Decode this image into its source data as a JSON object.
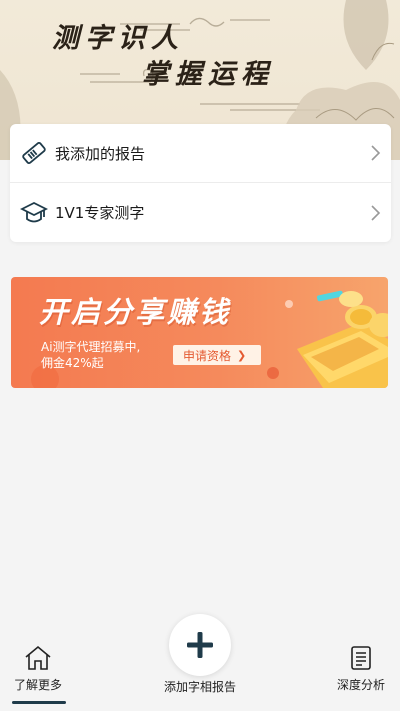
{
  "hero": {
    "title_line1": "测字识人",
    "title_line2": "掌握运程"
  },
  "menu": {
    "items": [
      {
        "label": "我添加的报告",
        "icon": "ticket-icon"
      },
      {
        "label": "1V1专家测字",
        "icon": "graduation-cap-icon"
      }
    ]
  },
  "banner": {
    "title": "开启分享赚钱",
    "subtitle_line1": "Ai测字代理招募中,",
    "subtitle_line2": "佣金42%起",
    "button_label": "申请资格"
  },
  "tabbar": {
    "items": [
      {
        "label": "了解更多",
        "icon": "home-icon",
        "active": true
      },
      {
        "label": "添加字相报告",
        "icon": "plus-icon"
      },
      {
        "label": "深度分析",
        "icon": "document-icon"
      }
    ]
  },
  "colors": {
    "accent_dark": "#1f3b4a",
    "banner_orange": "#f47a50",
    "hero_bg": "#f2ead9"
  }
}
